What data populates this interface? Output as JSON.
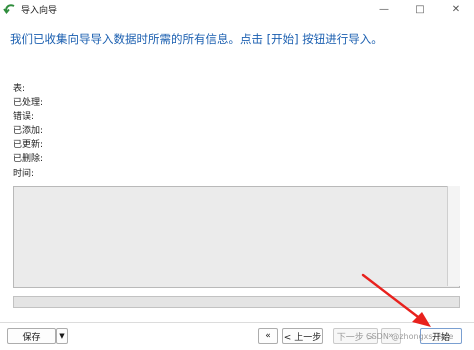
{
  "window": {
    "title": "导入向导",
    "icon": "import-wizard-icon",
    "controls": {
      "minimize": "—",
      "maximize": "□",
      "close": "✕"
    }
  },
  "headline": "我们已收集向导导入数据时所需的所有信息。点击 [开始] 按钮进行导入。",
  "info_labels": [
    "表:",
    "已处理:",
    "错误:",
    "已添加:",
    "已更新:",
    "已删除:",
    "时间:"
  ],
  "log": {
    "text": ""
  },
  "progress": {
    "value": 0
  },
  "footer": {
    "save_label": "保存",
    "save_dropdown": "▼",
    "first_label": "«",
    "prev_label": "< 上一步",
    "next_label": "下一步 >",
    "last_label": "»",
    "start_label": "开始"
  },
  "watermark": "CSDN @zhongxs_zafe",
  "colors": {
    "headline": "#1b5fb0",
    "annotation_arrow": "#e8211d",
    "progress_fill": "#33a24a"
  }
}
